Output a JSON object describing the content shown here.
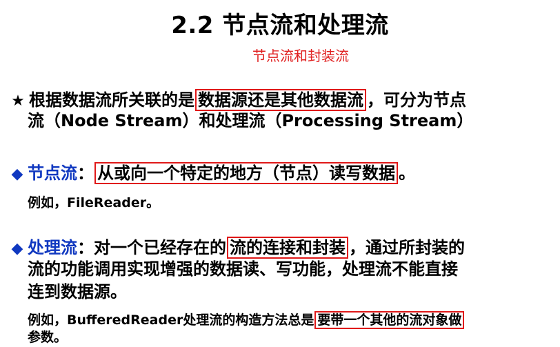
{
  "title": "2.2 节点流和处理流",
  "subtitle": "节点流和封装流",
  "icons": {
    "star": "★",
    "diamond": "◆"
  },
  "colors": {
    "highlight_border": "#e01818",
    "subtitle": "#e02020",
    "term": "#1038c0"
  },
  "intro": {
    "before_box": "根据数据流所关联的是",
    "boxed": "数据源还是其他数据流",
    "after_box": "，可分为节点",
    "line2": "流（Node Stream）和处理流（Processing Stream）"
  },
  "node_stream": {
    "term": "节点流",
    "colon": "：",
    "boxed": "从或向一个特定的地方（节点）读写数据",
    "end": "。",
    "example": "例如，FileReader。"
  },
  "processing_stream": {
    "term": "处理流",
    "colon": "：",
    "before_box": "对一个已经存在的",
    "boxed": "流的连接和封装",
    "after_box": "，通过所封装的",
    "line2": "流的功能调用实现增强的数据读、写功能，处理流不能直接",
    "line3": "连到数据源。",
    "example_before": "例如，BufferedReader处理流的构造方法总是",
    "example_boxed": "要带一个其他的流对象做",
    "example_line2": "参数。"
  }
}
